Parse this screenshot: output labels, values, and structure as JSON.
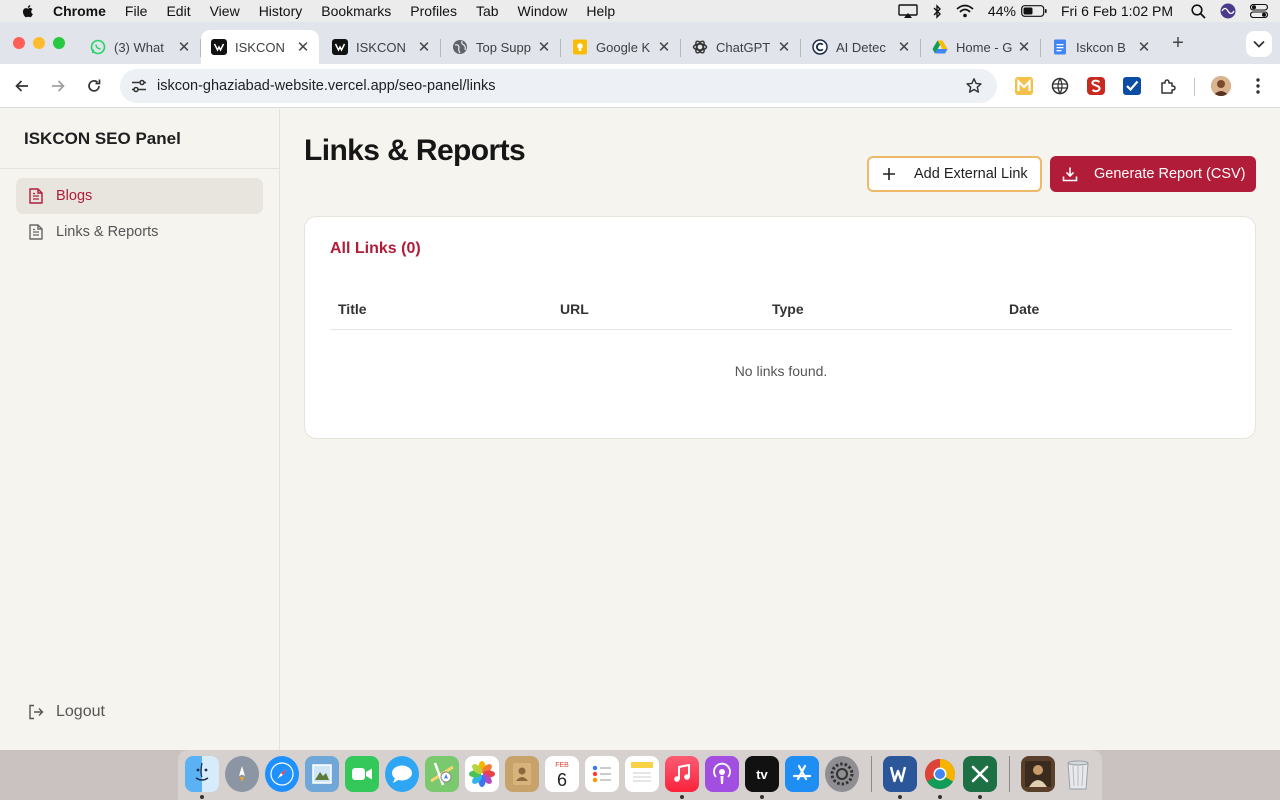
{
  "menubar": {
    "app": "Chrome",
    "items": [
      "File",
      "Edit",
      "View",
      "History",
      "Bookmarks",
      "Profiles",
      "Tab",
      "Window",
      "Help"
    ],
    "battery": "44%",
    "datetime": "Fri 6 Feb  1:02 PM"
  },
  "tabs": [
    {
      "title": "(3) What",
      "icon": "whatsapp-icon"
    },
    {
      "title": "ISKCON",
      "icon": "vercel-icon"
    },
    {
      "title": "ISKCON",
      "icon": "vercel-icon"
    },
    {
      "title": "Top Supp",
      "icon": "globe-icon"
    },
    {
      "title": "Google K",
      "icon": "google-keep-icon"
    },
    {
      "title": "ChatGPT",
      "icon": "chatgpt-icon"
    },
    {
      "title": "AI Detec",
      "icon": "copyleaks-icon"
    },
    {
      "title": "Home - G",
      "icon": "google-drive-icon"
    },
    {
      "title": "Iskcon B",
      "icon": "google-docs-icon"
    }
  ],
  "address_bar": {
    "url": "iskcon-ghaziabad-website.vercel.app/seo-panel/links"
  },
  "sidebar": {
    "brand": "ISKCON SEO Panel",
    "items": [
      {
        "label": "Blogs",
        "icon": "document-icon"
      },
      {
        "label": "Links & Reports",
        "icon": "document-icon"
      }
    ],
    "logout": "Logout"
  },
  "main": {
    "title": "Links & Reports",
    "add_button": "Add External Link",
    "report_button": "Generate Report (CSV)",
    "card_title": "All Links (0)",
    "columns": [
      "Title",
      "URL",
      "Type",
      "Date"
    ],
    "empty_message": "No links found."
  },
  "dock": {
    "calendar_month": "FEB",
    "calendar_day": "6",
    "tv_label": "tv"
  },
  "colors": {
    "accent": "#b11c38",
    "outline_button_border": "#f0b96a",
    "page_background": "#f5f4ef"
  }
}
